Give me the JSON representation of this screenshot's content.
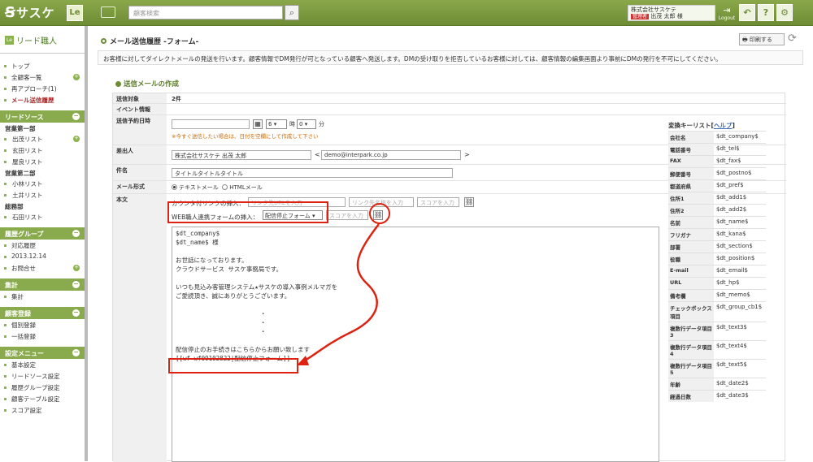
{
  "app": {
    "logo": "サスケ",
    "le_label": "Le"
  },
  "search": {
    "placeholder": "顧客検索"
  },
  "user": {
    "company": "株式会社サスケテ",
    "role_tag": "管理者",
    "name": "出茂 太郎 様",
    "logout": "Logout"
  },
  "topbar_buttons": [
    "?"
  ],
  "sidebar": {
    "title": "リード職人",
    "nav": [
      "トップ",
      "全顧客一覧",
      "再アプローチ(1)",
      "メール送信履歴"
    ],
    "lead_source": {
      "head": "リードソース",
      "groups": [
        {
          "name": "営業第一部",
          "items": [
            "出茂リスト",
            "玄田リスト",
            "屋良リスト"
          ]
        },
        {
          "name": "営業第二部",
          "items": [
            "小林リスト",
            "土井リスト"
          ]
        },
        {
          "name": "総務部",
          "items": [
            "石田リスト"
          ]
        }
      ]
    },
    "history": {
      "head": "履歴グループ",
      "items": [
        "対応履歴",
        "2013.12.14",
        "お問合せ"
      ]
    },
    "totals": {
      "head": "集計",
      "items": [
        "集計"
      ]
    },
    "register": {
      "head": "顧客登録",
      "items": [
        "個別登録",
        "一括登録"
      ]
    },
    "settings": {
      "head": "設定メニュー",
      "items": [
        "基本設定",
        "リードソース設定",
        "履歴グループ設定",
        "顧客テーブル設定",
        "スコア設定"
      ]
    }
  },
  "page": {
    "title": "メール送信履歴 -フォーム-",
    "print": "印刷する",
    "description": "お客様に対してダイレクトメールの発送を行います。顧客情報でDM発行が可となっている顧客へ発送します。DMの受け取りを拒否しているお客様に対しては、顧客情報の編集画面より事前にDMの発行を不可にしてください。"
  },
  "form": {
    "section": "送信メールの作成",
    "labels": {
      "target": "送信対象",
      "event": "イベント情報",
      "schedule": "送信予約日時",
      "sender": "差出人",
      "subject": "件名",
      "format": "メール形式",
      "body": "本文"
    },
    "target_value": "2件",
    "hour": "6",
    "minute": "0",
    "hour_unit": "時",
    "minute_unit": "分",
    "schedule_note": "※今すぐ送信したい場合は、日付を空欄にして作成して下さい",
    "sender_name": "株式会社サスケテ 出茂 太郎",
    "sender_email": "demo@interpark.co.jp",
    "subject_value": "タイトルタイトルタイトル",
    "format_text": "テキストメール",
    "format_html": "HTMLメール",
    "counter_label": "カウンタ付リンクの挿入：",
    "url_ph": "リンク先URLを入力",
    "name_ph": "リンク先名称を入力",
    "score_ph": "スコアを入力",
    "web_label": "WEB職人連携フォームの挿入：",
    "web_select": "配信停止フォーム",
    "web_score_ph": "スコアを入力",
    "body_text": "$dt_company$\n$dt_name$ 様\n\nお世話になっております。\nクラウドサービス サスケ事務局です。\n\nいつも見込み客管理システム★サスケの導入事例メルマガを\nご愛読頂き、誠にありがとうございます。\n\n                       ・\n                       ・\n                       ・\n\n配信停止のお手続きはこちらからお願い致します\n[[wf-wf09102822|配信停止フォーム]]"
  },
  "keylist": {
    "title": "変換キーリスト",
    "help": "ヘルプ",
    "rows": [
      [
        "会社名",
        "$dt_company$"
      ],
      [
        "電話番号",
        "$dt_tel$"
      ],
      [
        "FAX",
        "$dt_fax$"
      ],
      [
        "郵便番号",
        "$dt_postno$"
      ],
      [
        "都道府県",
        "$dt_pref$"
      ],
      [
        "住所1",
        "$dt_add1$"
      ],
      [
        "住所2",
        "$dt_add2$"
      ],
      [
        "名前",
        "$dt_name$"
      ],
      [
        "フリガナ",
        "$dt_kana$"
      ],
      [
        "部署",
        "$dt_section$"
      ],
      [
        "役職",
        "$dt_position$"
      ],
      [
        "E-mail",
        "$dt_email$"
      ],
      [
        "URL",
        "$dt_hp$"
      ],
      [
        "備考欄",
        "$dt_memo$"
      ],
      [
        "チェックボックス項目",
        "$dt_group_cb1$"
      ],
      [
        "複数行データ項目3",
        "$dt_text3$"
      ],
      [
        "複数行データ項目4",
        "$dt_text4$"
      ],
      [
        "複数行データ項目5",
        "$dt_text5$"
      ],
      [
        "年齢",
        "$dt_date2$"
      ],
      [
        "経過日数",
        "$dt_date3$"
      ]
    ]
  }
}
